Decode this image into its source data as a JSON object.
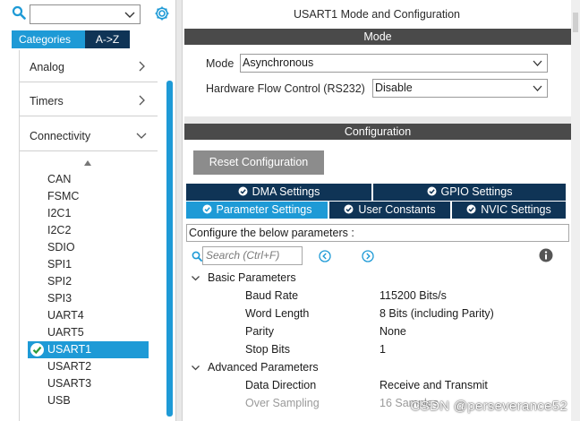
{
  "left": {
    "tabs": [
      "Categories",
      "A->Z"
    ],
    "categories": [
      "Analog",
      "Timers",
      "Connectivity"
    ],
    "connectivity_items": [
      "CAN",
      "FSMC",
      "I2C1",
      "I2C2",
      "SDIO",
      "SPI1",
      "SPI2",
      "SPI3",
      "UART4",
      "UART5",
      "USART1",
      "USART2",
      "USART3",
      "USB"
    ],
    "selected_item": "USART1"
  },
  "right": {
    "title": "USART1 Mode and Configuration",
    "mode_header": "Mode",
    "mode_label": "Mode",
    "mode_value": "Asynchronous",
    "hwfc_label": "Hardware Flow Control (RS232)",
    "hwfc_value": "Disable",
    "config_header": "Configuration",
    "reset_button": "Reset Configuration",
    "tabs_row1": [
      "DMA Settings",
      "GPIO Settings"
    ],
    "tabs_row2": [
      "Parameter Settings",
      "User Constants",
      "NVIC Settings"
    ],
    "active_tab": "Parameter Settings",
    "info_text": "Configure the below parameters :",
    "search_placeholder": "Search (Ctrl+F)",
    "groups": [
      {
        "name": "Basic Parameters",
        "params": [
          {
            "key": "Baud Rate",
            "value": "115200 Bits/s"
          },
          {
            "key": "Word Length",
            "value": "8 Bits (including Parity)"
          },
          {
            "key": "Parity",
            "value": "None"
          },
          {
            "key": "Stop Bits",
            "value": "1"
          }
        ]
      },
      {
        "name": "Advanced Parameters",
        "params": [
          {
            "key": "Data Direction",
            "value": "Receive and Transmit"
          },
          {
            "key": "Over Sampling",
            "value": "16 Samples"
          }
        ]
      }
    ],
    "watermark": "CSDN @perseverance52"
  },
  "colors": {
    "accent": "#1e9ad6",
    "dark_tab": "#0f3456",
    "header_band": "#4a4a4a",
    "reset_button": "#8c8c8c"
  }
}
